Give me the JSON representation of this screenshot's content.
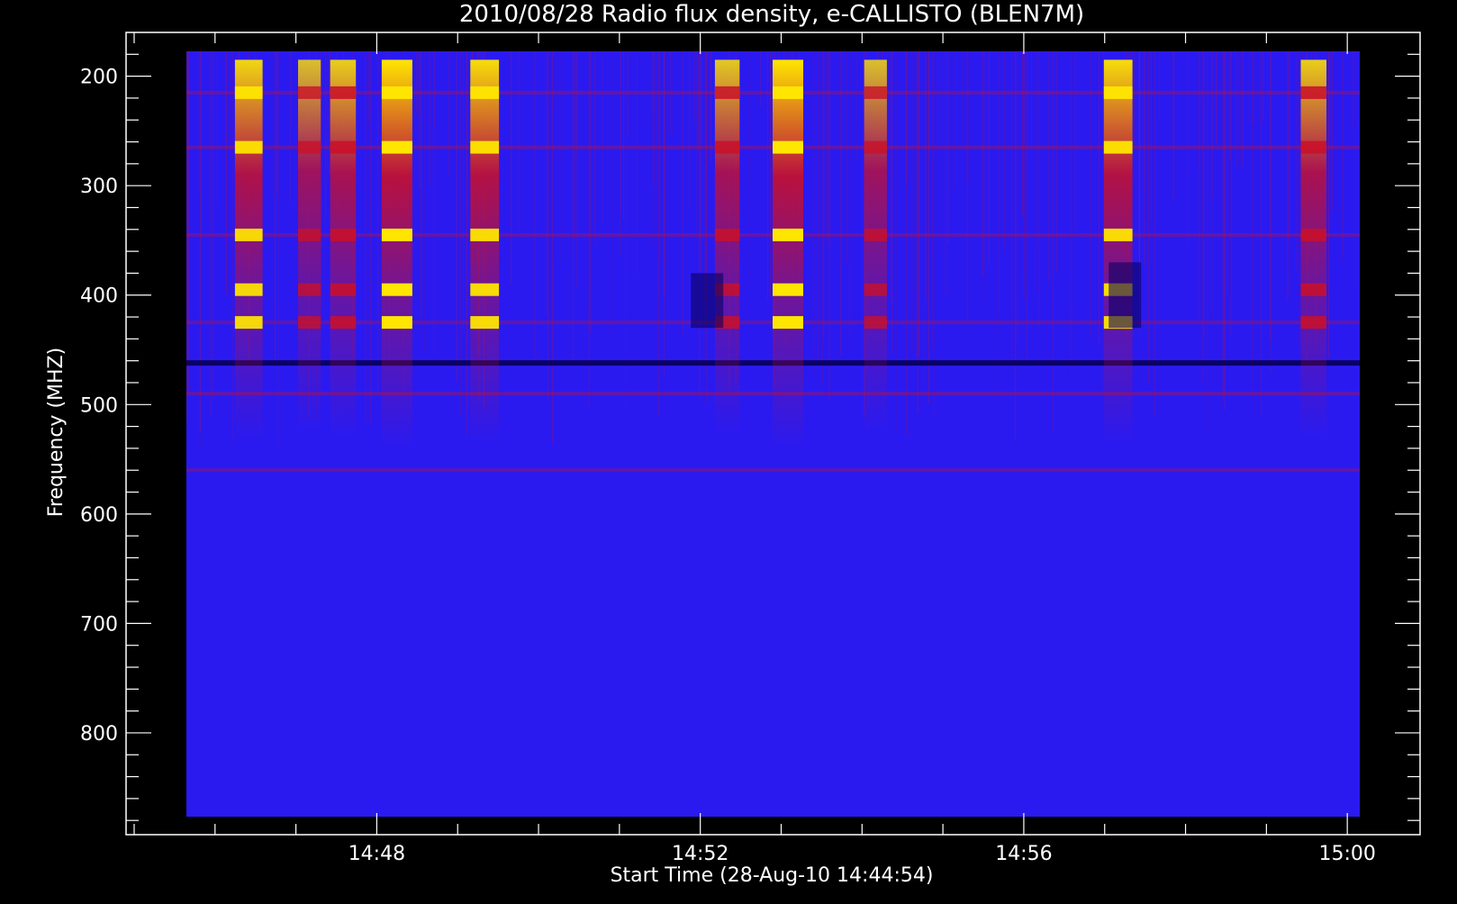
{
  "chart_data": {
    "type": "heatmap",
    "title": "2010/08/28  Radio flux density, e-CALLISTO (BLEN7M)",
    "xlabel": "Start Time (28-Aug-10 14:44:54)",
    "ylabel": "Frequency (MHZ)",
    "x_unit": "time (HH:MM)",
    "y_unit": "MHz",
    "xlim": [
      "14:45:00",
      "15:00:15"
    ],
    "ylim": [
      175,
      870
    ],
    "y_inverted": true,
    "x_ticks": [
      {
        "label": "14:48",
        "value_min": 48
      },
      {
        "label": "14:52",
        "value_min": 52
      },
      {
        "label": "14:56",
        "value_min": 56
      },
      {
        "label": "15:00",
        "value_min": 60
      }
    ],
    "y_ticks": [
      {
        "label": "200",
        "value": 200
      },
      {
        "label": "300",
        "value": 300
      },
      {
        "label": "400",
        "value": 400
      },
      {
        "label": "500",
        "value": 500
      },
      {
        "label": "600",
        "value": 600
      },
      {
        "label": "700",
        "value": 700
      },
      {
        "label": "800",
        "value": 800
      }
    ],
    "colormap": {
      "background": "#2a1af0",
      "low": "#0a0060",
      "mid": "#c8102a",
      "high": "#ffe600",
      "peak": "#ffffff"
    },
    "burst_events": [
      {
        "time": "14:46:25",
        "intensity": 0.85
      },
      {
        "time": "14:47:10",
        "intensity": 0.6
      },
      {
        "time": "14:47:35",
        "intensity": 0.75
      },
      {
        "time": "14:48:15",
        "intensity": 1.0
      },
      {
        "time": "14:49:20",
        "intensity": 0.9
      },
      {
        "time": "14:52:20",
        "intensity": 0.7
      },
      {
        "time": "14:53:05",
        "intensity": 1.0
      },
      {
        "time": "14:54:10",
        "intensity": 0.6
      },
      {
        "time": "14:57:10",
        "intensity": 0.9
      },
      {
        "time": "14:59:35",
        "intensity": 0.75
      }
    ],
    "persistent_bands_mhz": [
      215,
      265,
      345,
      425,
      462,
      490,
      560
    ],
    "grid": false,
    "legend": "none"
  }
}
